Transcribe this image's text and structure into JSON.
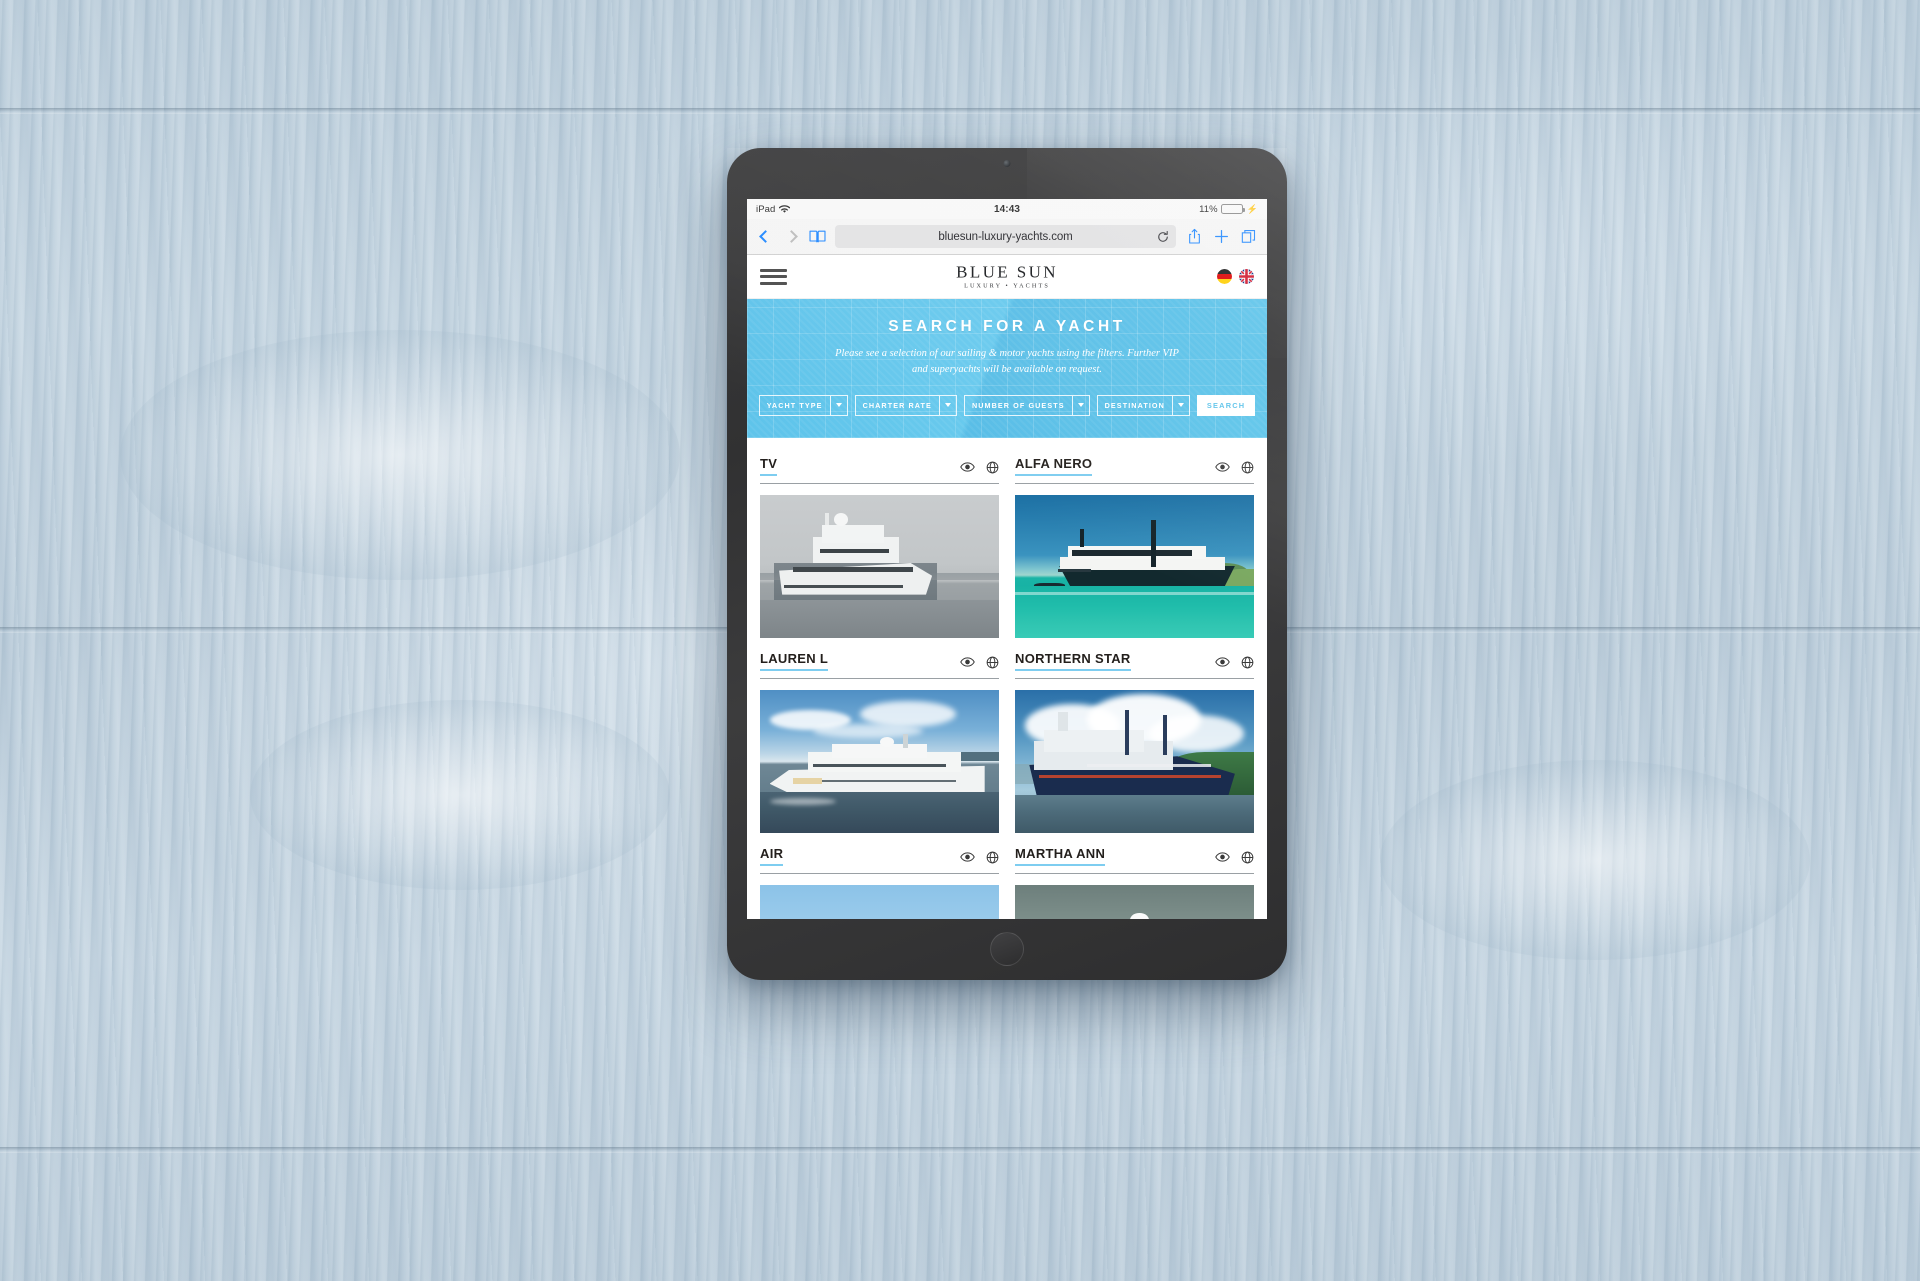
{
  "device": {
    "name": "iPad",
    "status_bar": {
      "carrier_label": "iPad",
      "wifi_icon": "wifi-icon",
      "time": "14:43",
      "battery_percent": "11%",
      "battery_level": 11,
      "charging_icon": "lightning-bolt-icon",
      "battery_color": "#4cd964"
    }
  },
  "browser": {
    "back_icon": "chevron-left-icon",
    "forward_icon": "chevron-right-icon",
    "bookmarks_icon": "book-icon",
    "url": "bluesun-luxury-yachts.com",
    "reload_icon": "reload-icon",
    "share_icon": "share-icon",
    "new_tab_icon": "plus-icon",
    "tabs_icon": "tabs-icon",
    "accent_color": "#1f87ff"
  },
  "site": {
    "header": {
      "menu_icon": "hamburger-menu-icon",
      "logo_main": "BLUE SUN",
      "logo_sub": "LUXURY • YACHTS",
      "languages": [
        {
          "name": "german-flag-icon",
          "label": "DE"
        },
        {
          "name": "uk-flag-icon",
          "label": "EN"
        }
      ]
    },
    "hero": {
      "title": "SEARCH FOR A YACHT",
      "subtitle": "Please see a selection of our sailing & motor yachts using the filters. Further VIP and superyachts will be available on request.",
      "background_color": "#5dc3ea",
      "filters": [
        {
          "label": "YACHT TYPE",
          "value": ""
        },
        {
          "label": "CHARTER RATE",
          "value": ""
        },
        {
          "label": "NUMBER OF GUESTS",
          "value": ""
        },
        {
          "label": "DESTINATION",
          "value": ""
        }
      ],
      "search_button": "SEARCH"
    },
    "results": {
      "accent_underline": "#7ecdf0",
      "view_icon": "eye-icon",
      "compare_icon": "globe-icon",
      "yachts": [
        {
          "name": "TV",
          "photo": "yacht-photo-tv"
        },
        {
          "name": "ALFA NERO",
          "photo": "yacht-photo-alfa-nero"
        },
        {
          "name": "LAUREN L",
          "photo": "yacht-photo-lauren-l"
        },
        {
          "name": "NORTHERN STAR",
          "photo": "yacht-photo-northern-star"
        },
        {
          "name": "AIR",
          "photo": "yacht-photo-air"
        },
        {
          "name": "MARTHA ANN",
          "photo": "yacht-photo-martha-ann"
        }
      ]
    }
  }
}
